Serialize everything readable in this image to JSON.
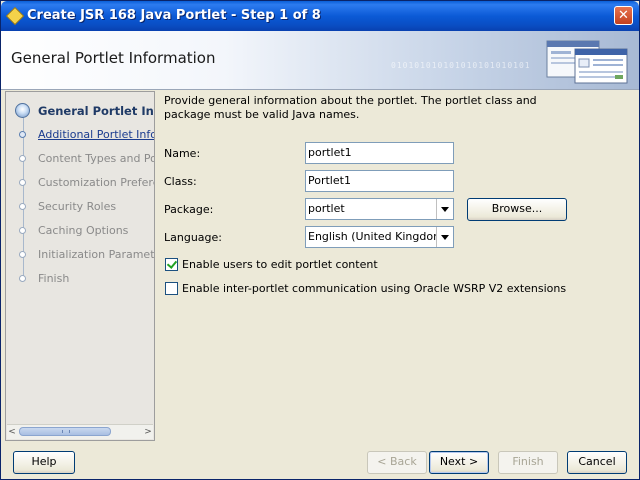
{
  "window": {
    "title": "Create JSR 168 Java Portlet - Step 1 of 8",
    "close_symbol": "✕"
  },
  "header": {
    "title": "General Portlet Information",
    "binary_text": "010101010101010101010101"
  },
  "nav": {
    "items": [
      {
        "label": "General Portlet Information",
        "state": "current"
      },
      {
        "label": "Additional Portlet Information",
        "state": "link"
      },
      {
        "label": "Content Types and Portlet Modes",
        "state": "disabled"
      },
      {
        "label": "Customization Preferences",
        "state": "disabled"
      },
      {
        "label": "Security Roles",
        "state": "disabled"
      },
      {
        "label": "Caching Options",
        "state": "disabled"
      },
      {
        "label": "Initialization Parameters",
        "state": "disabled"
      },
      {
        "label": "Finish",
        "state": "disabled"
      }
    ]
  },
  "form": {
    "description": "Provide general information about the portlet. The portlet class and package must be valid Java names.",
    "name_label": "Name:",
    "name_value": "portlet1",
    "class_label": "Class:",
    "class_value": "Portlet1",
    "package_label": "Package:",
    "package_value": "portlet",
    "browse_label": "Browse...",
    "language_label": "Language:",
    "language_value": "English (United Kingdom)",
    "edit_checkbox_label": "Enable users to edit portlet content",
    "edit_checked": true,
    "wsrp_checkbox_label": "Enable inter-portlet communication using Oracle WSRP V2 extensions",
    "wsrp_checked": false
  },
  "buttons": {
    "help": "Help",
    "back": "< Back",
    "next": "Next >",
    "finish": "Finish",
    "cancel": "Cancel"
  },
  "icons": {
    "title": "jdeveloper-icon",
    "close": "close-icon",
    "header_graphic": "wizard-documents-graphic",
    "check": "checkmark-icon"
  }
}
